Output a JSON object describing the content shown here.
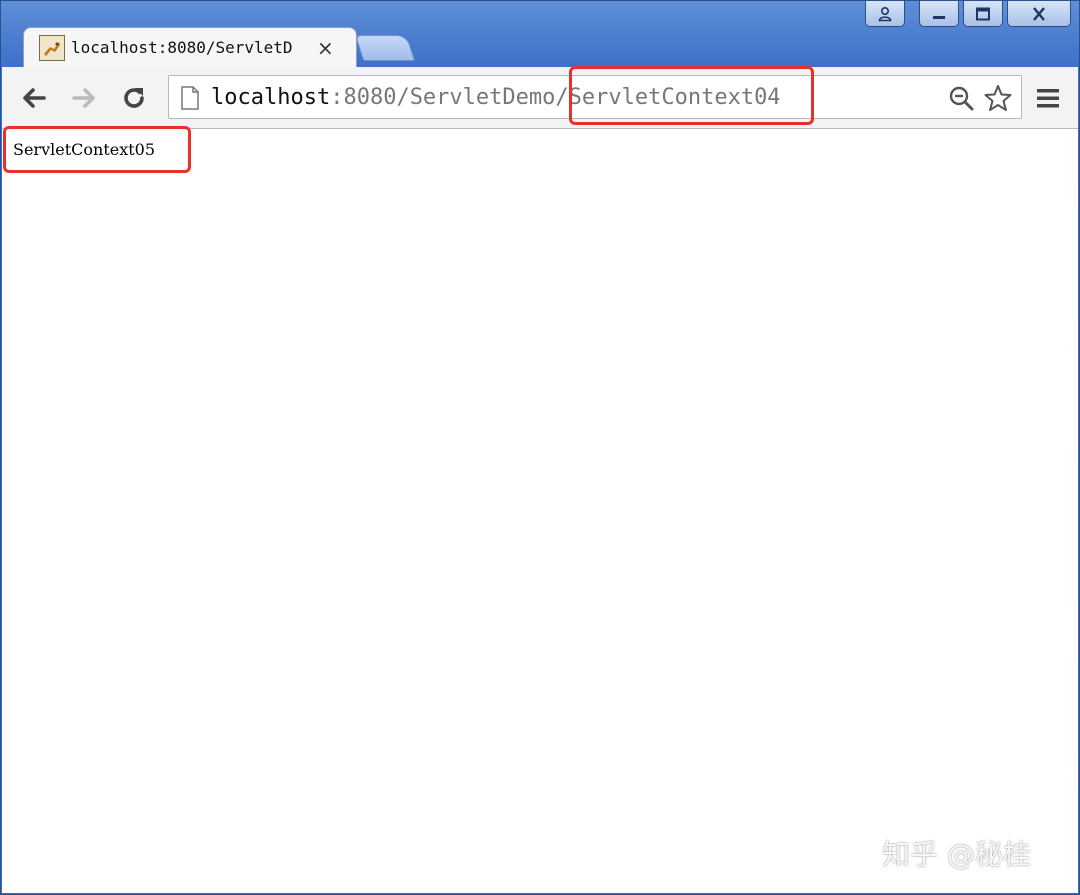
{
  "tab": {
    "title": "localhost:8080/ServletD",
    "close_glyph": "×"
  },
  "toolbar": {
    "back_icon": "back-arrow-icon",
    "forward_icon": "forward-arrow-icon",
    "reload_icon": "reload-icon",
    "menu_icon": "hamburger-menu-icon"
  },
  "address_bar": {
    "host": "localhost",
    "rest": ":8080/ServletDemo/ServletContext04"
  },
  "page": {
    "body_text": "ServletContext05"
  },
  "watermark": {
    "text": "知乎 @秘桂"
  },
  "colors": {
    "annotation_red": "#e8312a",
    "window_blue": "#3e71c9"
  }
}
